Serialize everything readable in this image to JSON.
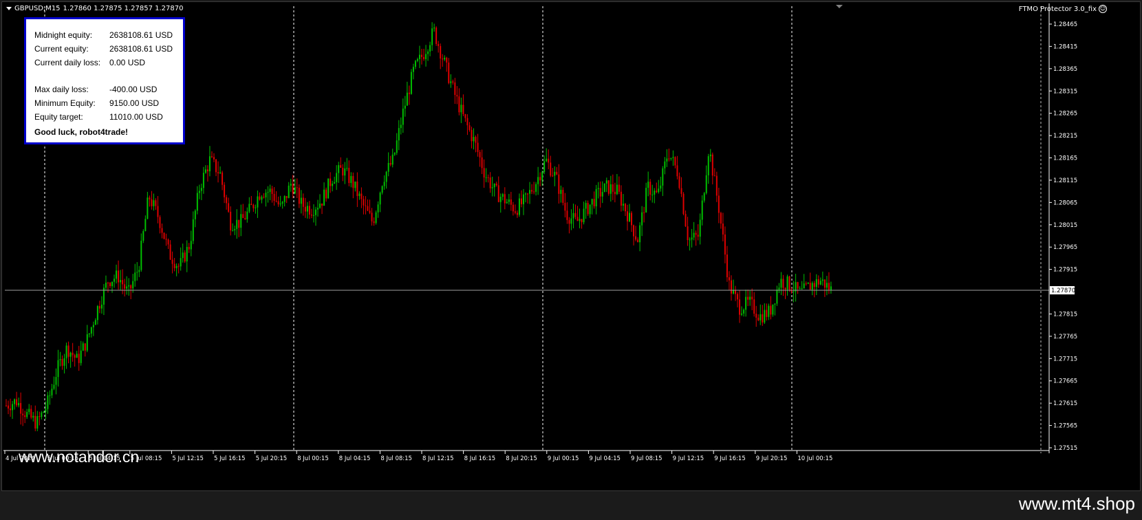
{
  "header": {
    "symbol_timeframe": "GBPUSD,M15",
    "ohlc": "1.27860 1.27875 1.27857 1.27870"
  },
  "expert": {
    "name": "FTMO Protector 3.0_fix",
    "icon": "smiley-icon"
  },
  "panel": {
    "midnight_equity_label": "Midnight equity:",
    "midnight_equity_value": "2638108.61 USD",
    "current_equity_label": "Current equity:",
    "current_equity_value": "2638108.61 USD",
    "daily_loss_label": "Current daily loss:",
    "daily_loss_value": "0.00 USD",
    "max_daily_loss_label": "Max daily loss:",
    "max_daily_loss_value": "-400.00 USD",
    "min_equity_label": "Minimum Equity:",
    "min_equity_value": "9150.00 USD",
    "equity_target_label": "Equity target:",
    "equity_target_value": "11010.00 USD",
    "greeting": "Good luck, robot4trade!",
    "border_color": "#0000cc"
  },
  "watermarks": {
    "left": "www.notandor.cn",
    "right": "www.mt4.shop"
  },
  "chart_data": {
    "type": "candlestick",
    "symbol": "GBPUSD",
    "timeframe": "M15",
    "up_color": "#00c000",
    "down_color": "#e00000",
    "current_price": "1.27870",
    "price_ticks": [
      "1.28465",
      "1.28415",
      "1.28365",
      "1.28315",
      "1.28265",
      "1.28215",
      "1.28165",
      "1.28115",
      "1.28065",
      "1.28015",
      "1.27965",
      "1.27915",
      "1.27870",
      "1.27815",
      "1.27765",
      "1.27715",
      "1.27665",
      "1.27615",
      "1.27565",
      "1.27515"
    ],
    "ylim": [
      1.275,
      1.2848
    ],
    "time_ticks": [
      "4 Jul 2024",
      "5 Jul 00:15",
      "5 Jul 04:15",
      "5 Jul 08:15",
      "5 Jul 12:15",
      "5 Jul 16:15",
      "5 Jul 20:15",
      "8 Jul 00:15",
      "8 Jul 04:15",
      "8 Jul 08:15",
      "8 Jul 12:15",
      "8 Jul 16:15",
      "8 Jul 20:15",
      "9 Jul 00:15",
      "9 Jul 04:15",
      "9 Jul 08:15",
      "9 Jul 12:15",
      "9 Jul 16:15",
      "9 Jul 20:15",
      "10 Jul 00:15"
    ],
    "day_separators": [
      "5 Jul 00:00",
      "8 Jul 00:00",
      "9 Jul 00:00",
      "10 Jul 00:00"
    ],
    "close_path": [
      1.2761,
      1.2762,
      1.2759,
      1.2757,
      1.2761,
      1.2769,
      1.2774,
      1.2771,
      1.2776,
      1.2783,
      1.2789,
      1.279,
      1.2786,
      1.2792,
      1.2808,
      1.2803,
      1.2795,
      1.2792,
      1.2797,
      1.281,
      1.2816,
      1.2813,
      1.2802,
      1.2802,
      1.2805,
      1.2809,
      1.2809,
      1.2805,
      1.2811,
      1.2806,
      1.2805,
      1.2807,
      1.2812,
      1.2814,
      1.2811,
      1.2806,
      1.2802,
      1.2812,
      1.2816,
      1.2827,
      1.2836,
      1.284,
      1.2845,
      1.2838,
      1.2831,
      1.2825,
      1.282,
      1.2813,
      1.2809,
      1.2807,
      1.2805,
      1.2807,
      1.2811,
      1.2816,
      1.2812,
      1.2804,
      1.2802,
      1.2805,
      1.2808,
      1.281,
      1.2809,
      1.2804,
      1.2798,
      1.281,
      1.2808,
      1.2818,
      1.2813,
      1.2798,
      1.2799,
      1.2819,
      1.2805,
      1.2788,
      1.2783,
      1.2784,
      1.2781,
      1.2782,
      1.2789,
      1.2788,
      1.2786,
      1.2788,
      1.2789,
      1.2787
    ]
  }
}
